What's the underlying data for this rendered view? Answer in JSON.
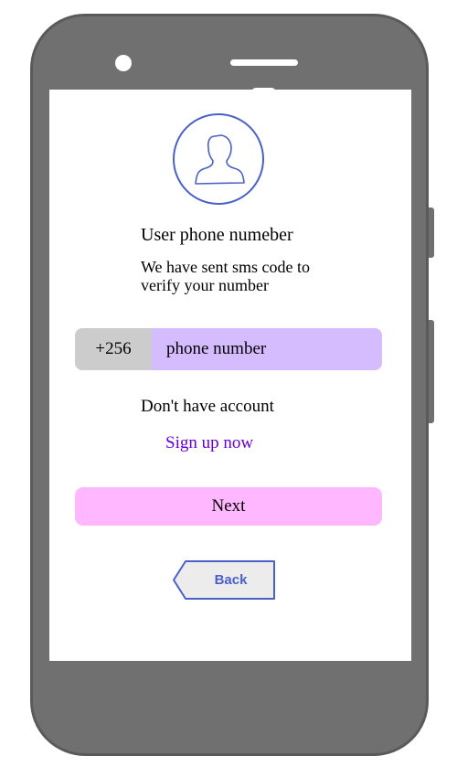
{
  "profile": {
    "icon": "user-avatar-icon",
    "icon_color": "#4a60c8"
  },
  "heading": {
    "title": "User phone numeber",
    "subtitle": "We have sent sms code to verify your number"
  },
  "phone_input": {
    "country_code": "+256",
    "placeholder": "phone number",
    "value": ""
  },
  "signup": {
    "prompt": "Don't have account",
    "link_label": "Sign up now"
  },
  "actions": {
    "next_label": "Next",
    "back_label": "Back"
  },
  "colors": {
    "device_body": "#707070",
    "accent": "#4a60c8",
    "input_bg": "#d5bcff",
    "code_bg": "#cccccc",
    "next_bg": "#ffb8ff",
    "link": "#6a00d6",
    "back_bg": "#ececec"
  }
}
